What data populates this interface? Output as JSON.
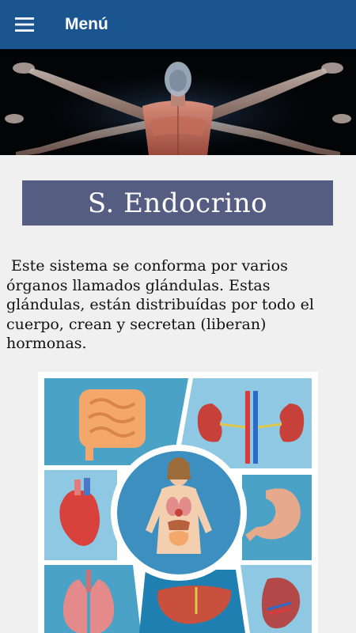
{
  "appbar": {
    "title": "Menú",
    "menu_icon": "hamburger-menu-icon",
    "background": "#1a5590"
  },
  "hero": {
    "image": "human-anatomy-figure-arms-outstretched"
  },
  "section": {
    "title": "S. Endocrino",
    "background": "#555d82"
  },
  "description": " Este sistema se conforma por varios órganos llamados glándulas. Estas glándulas, están distribuídas por todo el cuerpo, crean y secretan (liberan) hormonas.",
  "illustration": {
    "panels": [
      "intestines",
      "kidneys",
      "heart",
      "stomach",
      "lungs",
      "liver",
      "spleen",
      "female-body-organs"
    ]
  }
}
